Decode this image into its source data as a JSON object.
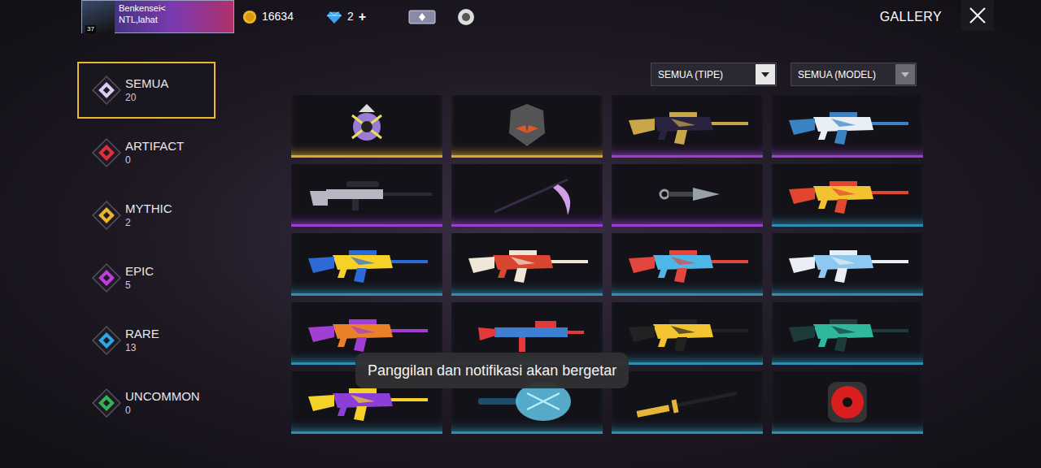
{
  "profile": {
    "name": "Benkensei<",
    "guild": "NTL,lahat",
    "level": "37"
  },
  "currency": [
    {
      "kind": "coin",
      "amount": "16634"
    },
    {
      "kind": "diamond",
      "amount": "2"
    }
  ],
  "add_button": "+",
  "title": "GALLERY",
  "categories": [
    {
      "label": "SEMUA",
      "count": "20",
      "selected": true,
      "color": "#d7cdf5"
    },
    {
      "label": "ARTIFACT",
      "count": "0",
      "selected": false,
      "color": "#e0303a"
    },
    {
      "label": "MYTHIC",
      "count": "2",
      "selected": false,
      "color": "#e9b52b"
    },
    {
      "label": "EPIC",
      "count": "5",
      "selected": false,
      "color": "#c13de0"
    },
    {
      "label": "RARE",
      "count": "13",
      "selected": false,
      "color": "#2fa6e0"
    },
    {
      "label": "UNCOMMON",
      "count": "0",
      "selected": false,
      "color": "#32b356"
    }
  ],
  "filters": [
    "SEMUA (TIPE)",
    "SEMUA (MODEL)"
  ],
  "items": [
    {
      "kind": "emblem",
      "rarity": "mythic",
      "color": "#d9a92e"
    },
    {
      "kind": "mask",
      "rarity": "mythic",
      "color": "#d9a92e"
    },
    {
      "kind": "rifle",
      "rarity": "epic",
      "color": "#9b3fcf"
    },
    {
      "kind": "rifle",
      "rarity": "epic",
      "color": "#9b3fcf"
    },
    {
      "kind": "sniper",
      "rarity": "epic",
      "color": "#9b3fcf"
    },
    {
      "kind": "scythe",
      "rarity": "epic",
      "color": "#9b3fcf"
    },
    {
      "kind": "kunai",
      "rarity": "epic",
      "color": "#9b3fcf"
    },
    {
      "kind": "rifle",
      "rarity": "rare",
      "color": "#2b8fb3"
    },
    {
      "kind": "rifle",
      "rarity": "rare",
      "color": "#2b8fb3"
    },
    {
      "kind": "rifle",
      "rarity": "rare",
      "color": "#2b8fb3"
    },
    {
      "kind": "rifle",
      "rarity": "rare",
      "color": "#2b8fb3"
    },
    {
      "kind": "rifle",
      "rarity": "rare",
      "color": "#2b8fb3"
    },
    {
      "kind": "rifle",
      "rarity": "rare",
      "color": "#2b8fb3"
    },
    {
      "kind": "smg",
      "rarity": "rare",
      "color": "#2b8fb3"
    },
    {
      "kind": "rifle",
      "rarity": "rare",
      "color": "#2b8fb3"
    },
    {
      "kind": "rifle",
      "rarity": "rare",
      "color": "#2b8fb3"
    },
    {
      "kind": "rifle",
      "rarity": "rare",
      "color": "#2b8fb3"
    },
    {
      "kind": "pan",
      "rarity": "rare",
      "color": "#2b8fb3"
    },
    {
      "kind": "katana",
      "rarity": "rare",
      "color": "#2b8fb3"
    },
    {
      "kind": "backpack",
      "rarity": "rare",
      "color": "#2b8fb3"
    }
  ],
  "toast": "Panggilan dan notifikasi akan bergetar"
}
